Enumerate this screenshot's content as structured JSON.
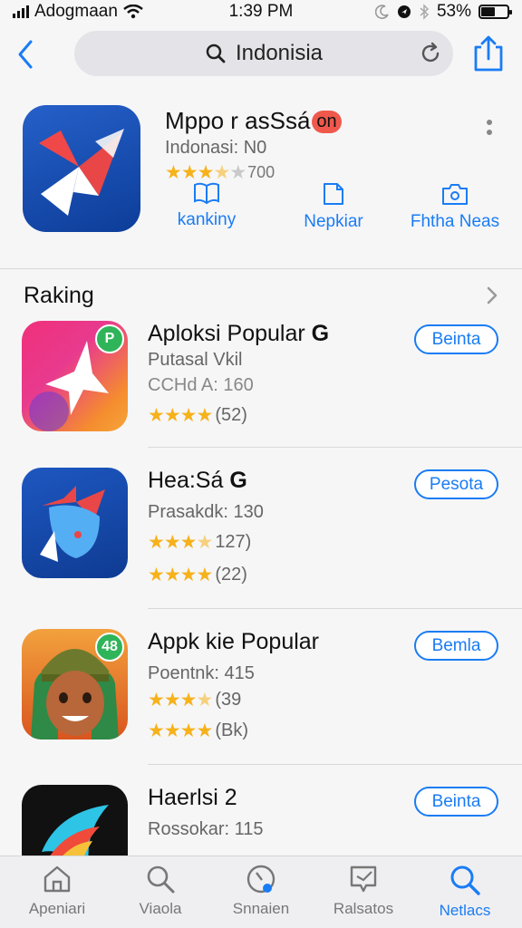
{
  "status": {
    "carrier": "Adogmaan",
    "time": "1:39 PM",
    "battery": "53%",
    "battery_level": 0.53
  },
  "nav": {
    "search_text": "Indonisia"
  },
  "hero": {
    "title": "Mppo r asSsá",
    "badge": "on",
    "subtitle": "Indonasi:  N0",
    "rating_count": "700",
    "stars": 3.5,
    "actions": [
      {
        "label": "kankiny",
        "icon": "book-icon"
      },
      {
        "label": "Nepkiar",
        "icon": "document-icon"
      },
      {
        "label": "Fhtha Neas",
        "icon": "camera-icon"
      }
    ]
  },
  "section": {
    "title": "Raking"
  },
  "apps": [
    {
      "name": "Aploksi Popular",
      "name_suffix": "G",
      "line1": "Putasal Vkil",
      "line2": "CCHd A: 160",
      "rating_label": "(52)",
      "get_label": "Beinta",
      "badge": "P",
      "colors": [
        "#f0307a",
        "#f58d2e",
        "#7a3bd6"
      ]
    },
    {
      "name": "Hea:Sá",
      "name_suffix": "G",
      "line1": "Prasakdk: 130",
      "line2_rating": "127)",
      "rating_label": "(22)",
      "get_label": "Pesota",
      "colors": [
        "#1e57c1",
        "#0e3b92"
      ]
    },
    {
      "name": "Appk kie Popular",
      "line1": "Poentnk: 415",
      "line2_rating": "(39",
      "rating_label": "(Bk)",
      "get_label": "Bemla",
      "badge": "48",
      "colors": [
        "#e58b2c",
        "#3aa15a"
      ]
    },
    {
      "name": "Haerlsi 2",
      "line1": "Rossokar: 115",
      "get_label": "Beinta",
      "colors": [
        "#111111",
        "#2ec4e6",
        "#f04a3a"
      ]
    }
  ],
  "tabs": [
    {
      "label": "Apeniari",
      "icon": "home-icon",
      "active": false
    },
    {
      "label": "Viaola",
      "icon": "search-icon",
      "active": false
    },
    {
      "label": "Snnaien",
      "icon": "compass-icon",
      "active": false
    },
    {
      "label": "Ralsatos",
      "icon": "inbox-icon",
      "active": false
    },
    {
      "label": "Netlacs",
      "icon": "search-icon",
      "active": true
    }
  ],
  "colors": {
    "accent": "#1a7cf4",
    "star": "#f6b21b",
    "badge_green": "#2fb45a",
    "badge_red": "#f0584c"
  }
}
